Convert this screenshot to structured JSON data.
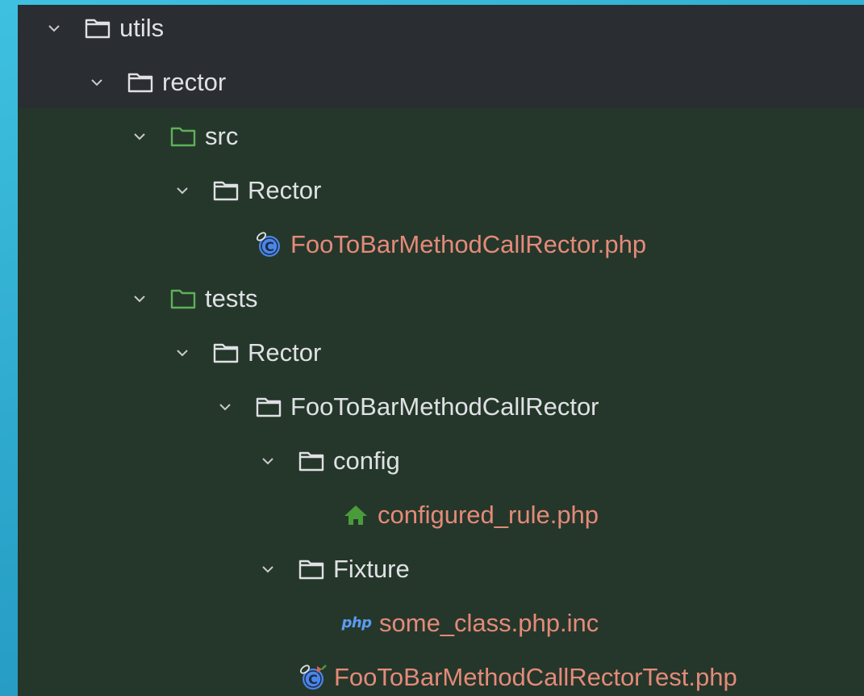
{
  "colors": {
    "background": "#35b6d9",
    "panel_top": "#2a2d31",
    "panel_green": "#25372a",
    "folder_icon": "#dfe1e5",
    "source_folder_icon": "#5fb05a",
    "file_label": "#e48a7a",
    "class_icon": "#4a86e8",
    "config_icon": "#4a9c3a"
  },
  "tree": [
    {
      "label": "utils",
      "icon": "folder-icon",
      "expanded": true
    },
    {
      "label": "rector",
      "icon": "folder-icon",
      "expanded": true
    },
    {
      "label": "src",
      "icon": "source-folder-icon",
      "expanded": true
    },
    {
      "label": "Rector",
      "icon": "folder-icon",
      "expanded": true
    },
    {
      "label": "FooToBarMethodCallRector.php",
      "icon": "php-class-icon"
    },
    {
      "label": "tests",
      "icon": "source-folder-icon",
      "expanded": true
    },
    {
      "label": "Rector",
      "icon": "folder-icon",
      "expanded": true
    },
    {
      "label": "FooToBarMethodCallRector",
      "icon": "folder-icon",
      "expanded": true
    },
    {
      "label": "config",
      "icon": "folder-icon",
      "expanded": true
    },
    {
      "label": "configured_rule.php",
      "icon": "config-home-icon"
    },
    {
      "label": "Fixture",
      "icon": "folder-icon",
      "expanded": true
    },
    {
      "label": "some_class.php.inc",
      "icon": "php-file-icon",
      "icon_text": "php"
    },
    {
      "label": "FooToBarMethodCallRectorTest.php",
      "icon": "php-test-class-icon"
    }
  ]
}
